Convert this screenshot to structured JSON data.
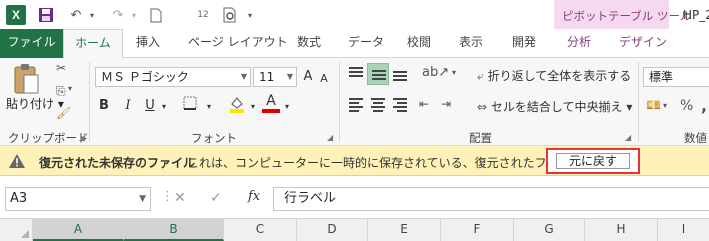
{
  "quick_access": {
    "icons": [
      "excel-logo",
      "save-icon",
      "undo-icon",
      "redo-icon",
      "new-file-icon",
      "calendar-icon",
      "print-preview-icon",
      "customize-icon"
    ],
    "calendar_day": "12"
  },
  "title": {
    "context_tab_title": "ピボットテーブル ツール",
    "filename": "HP_2"
  },
  "tabs": {
    "file": "ファイル",
    "home": "ホーム",
    "insert": "挿入",
    "page_layout": "ページ レイアウト",
    "formulas": "数式",
    "data": "データ",
    "review": "校閲",
    "view": "表示",
    "developer": "開発",
    "analyze": "分析",
    "design": "デザイン"
  },
  "ribbon": {
    "clipboard": {
      "paste_label": "貼り付け",
      "group_label": "クリップボード"
    },
    "font": {
      "font_name": "ＭＳ Ｐゴシック",
      "font_size": "11",
      "bold": "B",
      "italic": "I",
      "underline": "U",
      "group_label": "フォント"
    },
    "alignment": {
      "wrap_text": "折り返して全体を表示する",
      "merge_center": "セルを結合して中央揃え",
      "group_label": "配置"
    },
    "number": {
      "format": "標準",
      "group_label": "数値",
      "percent": "%",
      "comma": ","
    }
  },
  "message_bar": {
    "title": "復元された未保存のファイル",
    "text": "これは、コンピューターに一時的に保存されている、復元されたファイルです。",
    "button": "元に戻す"
  },
  "formula_bar": {
    "name_box": "A3",
    "cancel": "✕",
    "enter": "✓",
    "fx": "fx",
    "value": "行ラベル"
  },
  "columns": [
    "A",
    "B",
    "C",
    "D",
    "E",
    "F",
    "G",
    "H",
    "I"
  ],
  "colors": {
    "excel_green": "#217346",
    "context_pink": "#f4d9f0",
    "message_yellow": "#fff1b8",
    "highlight_red": "#e8323a"
  }
}
